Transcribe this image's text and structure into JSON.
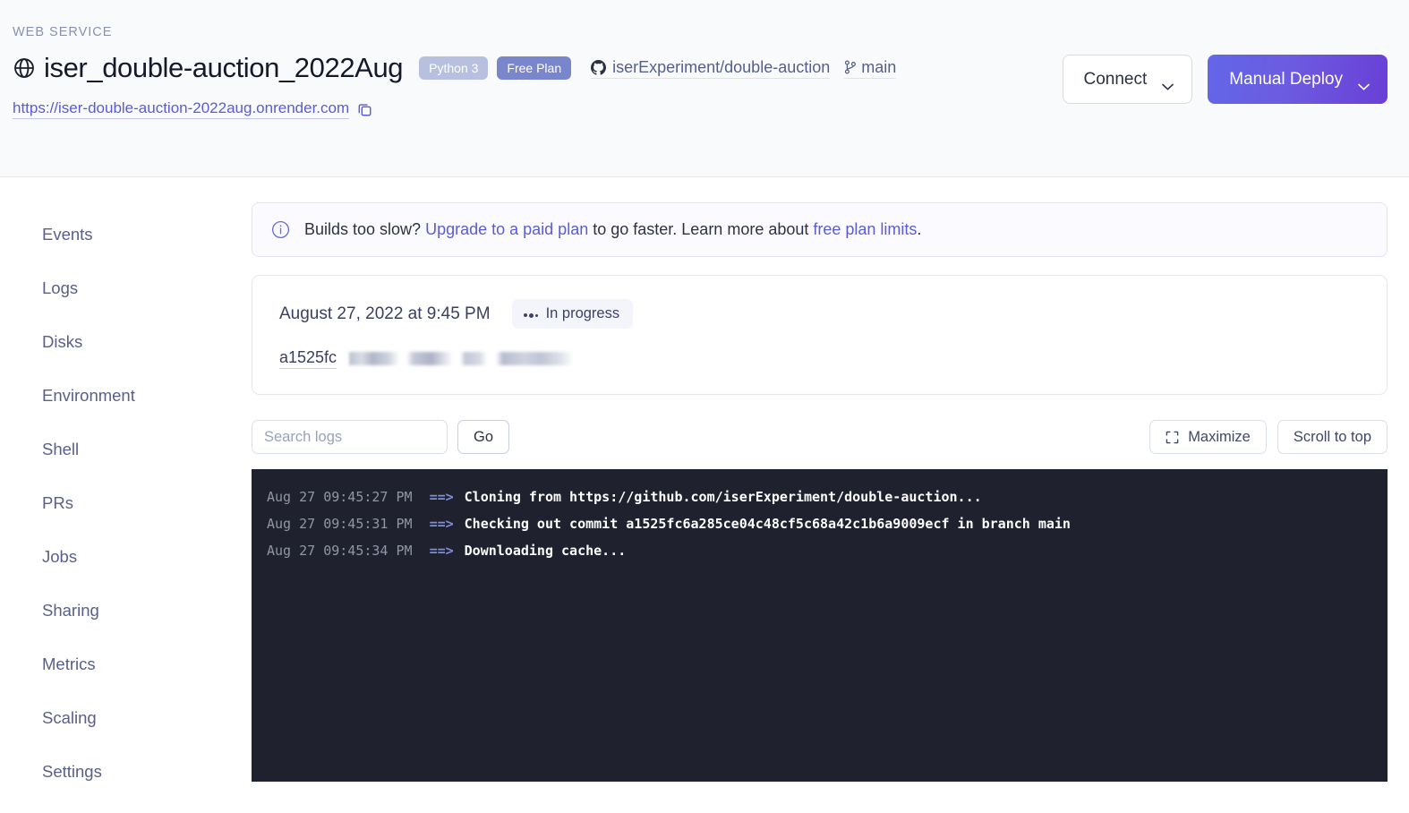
{
  "header": {
    "eyebrow": "WEB SERVICE",
    "service_name": "iser_double-auction_2022Aug",
    "globe_icon": "globe-icon",
    "badges": {
      "language": "Python 3",
      "plan": "Free Plan"
    },
    "repo": {
      "icon": "github-icon",
      "label": "iserExperiment/double-auction"
    },
    "branch": {
      "icon": "git-branch-icon",
      "label": "main"
    },
    "url": "https://iser-double-auction-2022aug.onrender.com",
    "copy_icon": "copy-icon",
    "connect_button": "Connect",
    "deploy_button": "Manual Deploy",
    "chevron_icon": "chevron-down-icon"
  },
  "sidebar": {
    "items": [
      {
        "label": "Events"
      },
      {
        "label": "Logs"
      },
      {
        "label": "Disks"
      },
      {
        "label": "Environment"
      },
      {
        "label": "Shell"
      },
      {
        "label": "PRs"
      },
      {
        "label": "Jobs"
      },
      {
        "label": "Sharing"
      },
      {
        "label": "Metrics"
      },
      {
        "label": "Scaling"
      },
      {
        "label": "Settings"
      }
    ]
  },
  "banner": {
    "icon": "info-circle-icon",
    "lead": "Builds too slow? ",
    "link1": "Upgrade to a paid plan",
    "mid": " to go faster. Learn more about ",
    "link2": "free plan limits",
    "tail": "."
  },
  "deploy": {
    "date": "August 27, 2022 at 9:45 PM",
    "status": "In progress",
    "status_icon": "three-dots-icon",
    "commit_sha": "a1525fc",
    "commit_message": ""
  },
  "log_controls": {
    "search_placeholder": "Search logs",
    "search_value": "",
    "go_label": "Go",
    "maximize_label": "Maximize",
    "maximize_icon": "maximize-icon",
    "scroll_top_label": "Scroll to top"
  },
  "logs": {
    "lines": [
      {
        "ts": "Aug 27 09:45:27 PM",
        "arrow": "==>",
        "msg": "Cloning from https://github.com/iserExperiment/double-auction..."
      },
      {
        "ts": "Aug 27 09:45:31 PM",
        "arrow": "==>",
        "msg": "Checking out commit a1525fc6a285ce04c48cf5c68a42c1b6a9009ecf in branch main"
      },
      {
        "ts": "Aug 27 09:45:34 PM",
        "arrow": "==>",
        "msg": "Downloading cache..."
      }
    ]
  },
  "colors": {
    "accent": "#5B5BD6",
    "deploy_gradient_start": "#6366E8",
    "deploy_gradient_end": "#6A3FD6",
    "plan_badge": "#7986CB",
    "lang_badge": "#B7C0DE",
    "console_bg": "#1F222E",
    "console_arrow": "#7E8FD6",
    "header_bg": "#F9FAFC"
  }
}
